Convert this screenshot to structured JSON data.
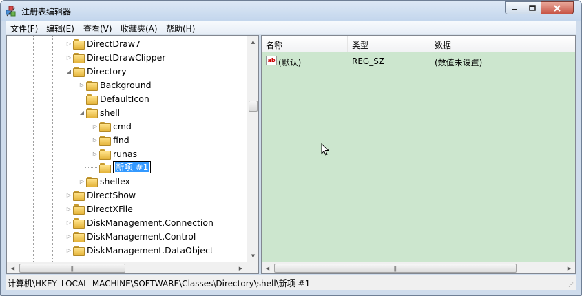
{
  "window": {
    "title": "注册表编辑器"
  },
  "menu": [
    "文件(F)",
    "编辑(E)",
    "查看(V)",
    "收藏夹(A)",
    "帮助(H)"
  ],
  "tree": [
    {
      "label": "DirectDraw7",
      "expander": "▷"
    },
    {
      "label": "DirectDrawClipper",
      "expander": "▷"
    },
    {
      "label": "Directory",
      "expander": "◢"
    },
    {
      "label": "Background",
      "expander": "▷"
    },
    {
      "label": "DefaultIcon",
      "expander": ""
    },
    {
      "label": "shell",
      "expander": "◢"
    },
    {
      "label": "cmd",
      "expander": "▷"
    },
    {
      "label": "find",
      "expander": "▷"
    },
    {
      "label": "runas",
      "expander": "▷"
    },
    {
      "label": "新项 #1",
      "expander": "",
      "editing": true
    },
    {
      "label": "shellex",
      "expander": "▷"
    },
    {
      "label": "DirectShow",
      "expander": "▷"
    },
    {
      "label": "DirectXFile",
      "expander": "▷"
    },
    {
      "label": "DiskManagement.Connection",
      "expander": "▷"
    },
    {
      "label": "DiskManagement.Control",
      "expander": "▷"
    },
    {
      "label": "DiskManagement.DataObject",
      "expander": "▷"
    }
  ],
  "list": {
    "columns": [
      "名称",
      "类型",
      "数据"
    ],
    "rows": [
      {
        "name": "(默认)",
        "type": "REG_SZ",
        "data": "(数值未设置)",
        "icon": "string-value-icon",
        "icon_text": "ab"
      }
    ]
  },
  "statusbar": {
    "path": "计算机\\HKEY_LOCAL_MACHINE\\SOFTWARE\\Classes\\Directory\\shell\\新项 #1"
  },
  "colors": {
    "list_background": "#cce6ce",
    "selection": "#3399ff",
    "folder": "#f0c85a"
  }
}
